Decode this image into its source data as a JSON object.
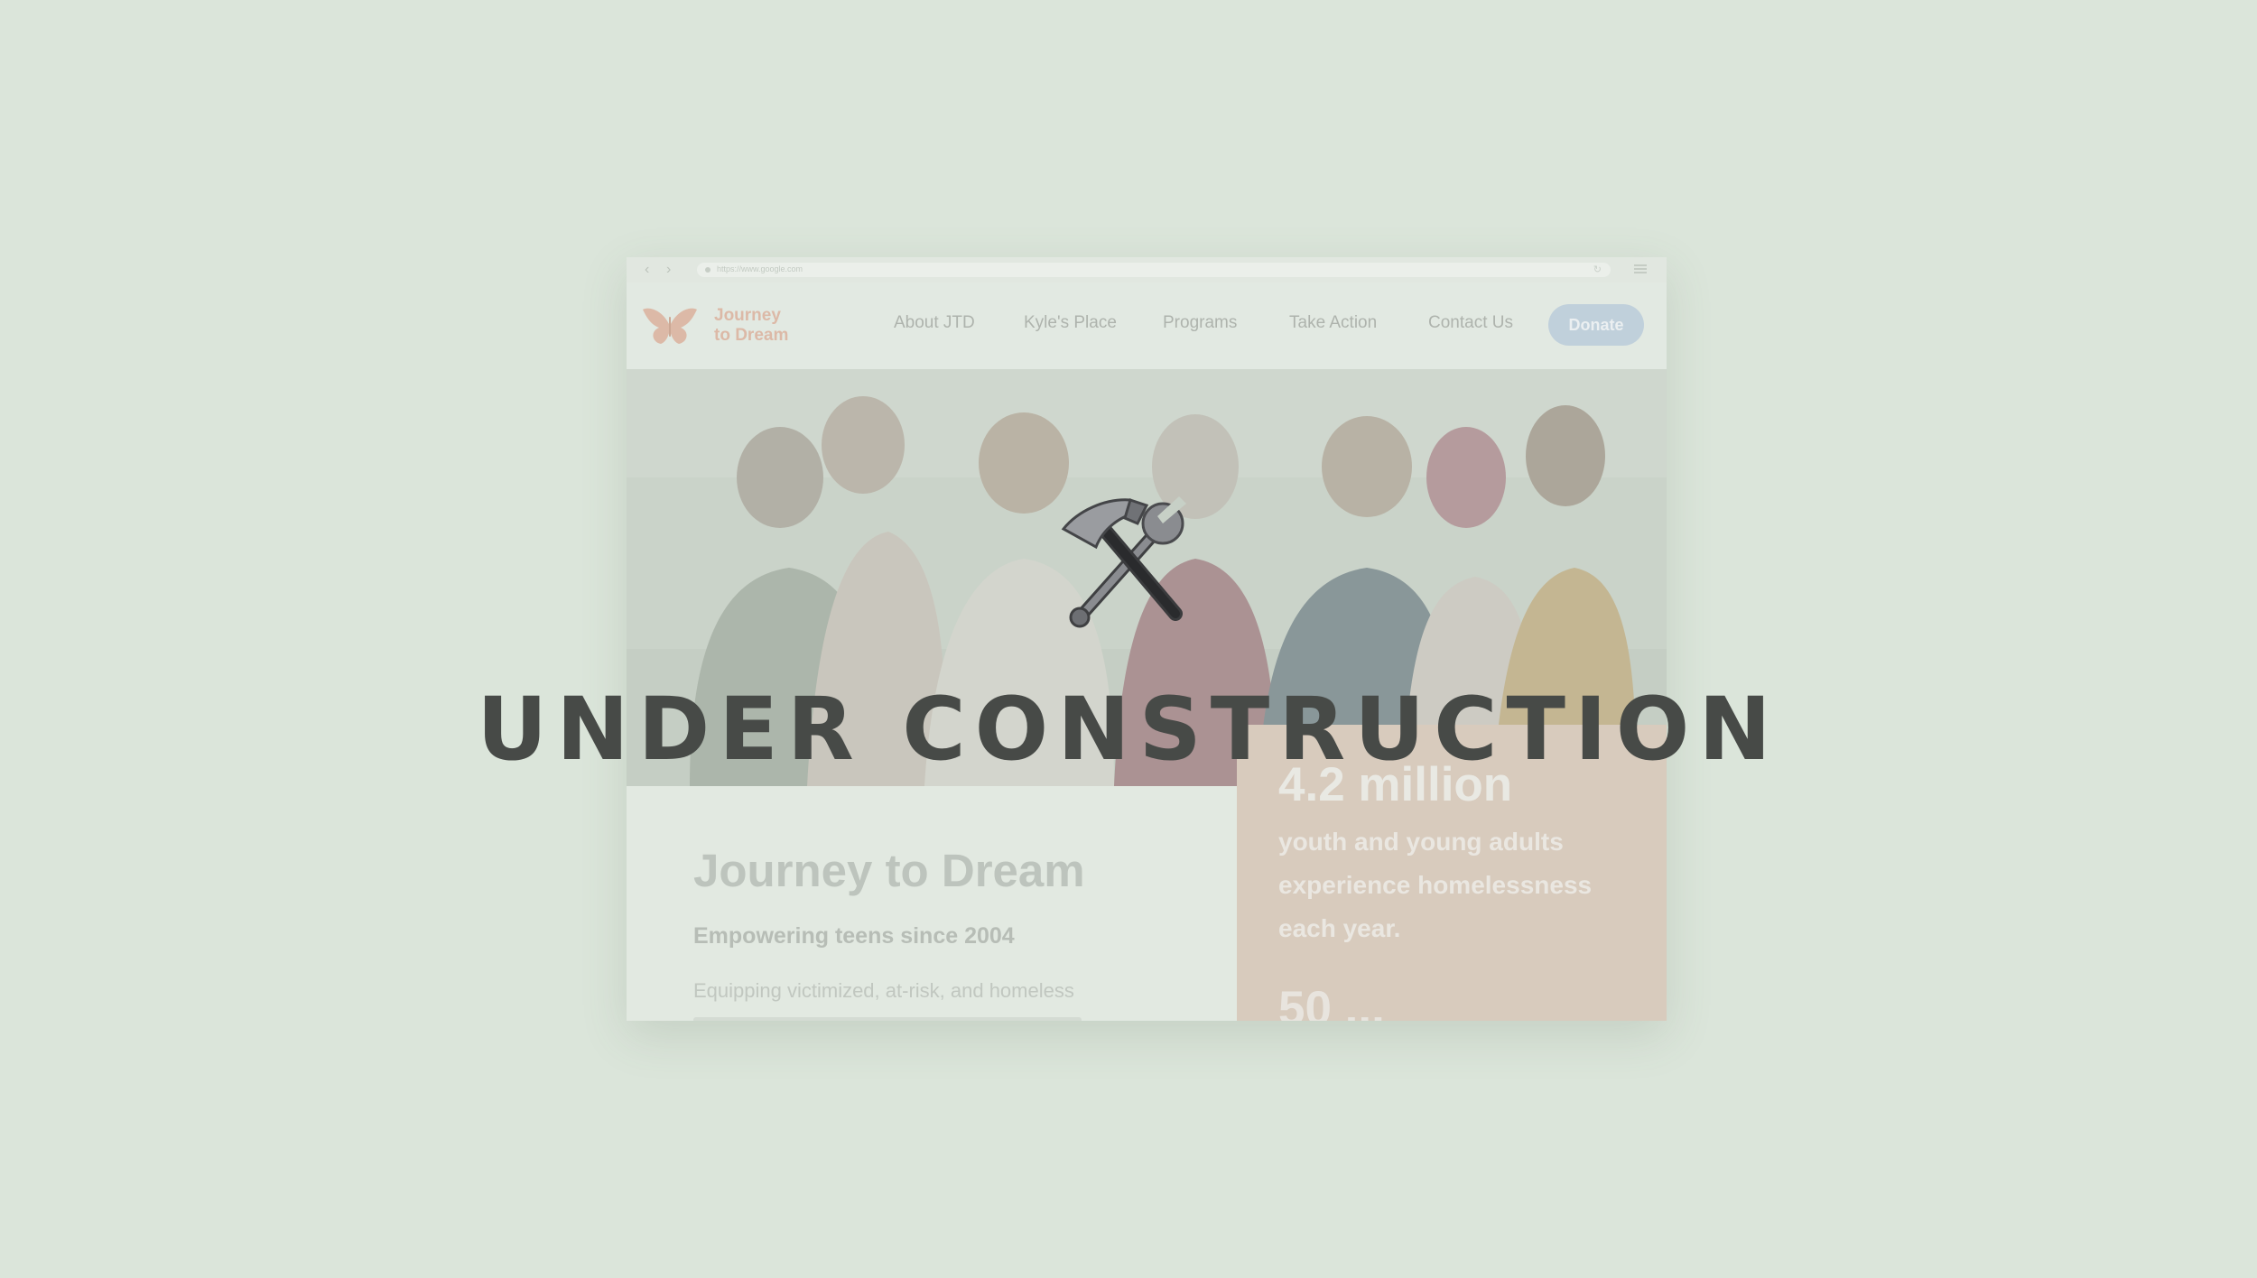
{
  "browser": {
    "url": "https://www.google.com",
    "back_icon": "chevron-left-icon",
    "forward_icon": "chevron-right-icon",
    "menu_icon": "hamburger-menu-icon"
  },
  "site": {
    "logo_icon": "butterfly-icon",
    "logo_line1": "Journey",
    "logo_line2": "to Dream",
    "nav": [
      "About JTD",
      "Kyle's Place",
      "Programs",
      "Take Action",
      "Contact Us"
    ],
    "donate_label": "Donate"
  },
  "intro": {
    "title": "Journey to Dream",
    "subtitle": "Empowering teens since 2004",
    "body": "Equipping victimized, at-risk, and homeless"
  },
  "stats": {
    "headline": "4.2 million",
    "text": "youth and young adults experience homelessness each year.",
    "next_partial": "50 ..."
  },
  "overlay": {
    "icon": "hammer-and-wrench-icon",
    "headline": "UNDER CONSTRUCTION"
  },
  "colors": {
    "page_background": "#dbe5da",
    "logo_accent": "#dcb39f",
    "donate_button": "#bccddb",
    "stats_panel": "#d8c7b9",
    "headline_text": "#474a47"
  }
}
